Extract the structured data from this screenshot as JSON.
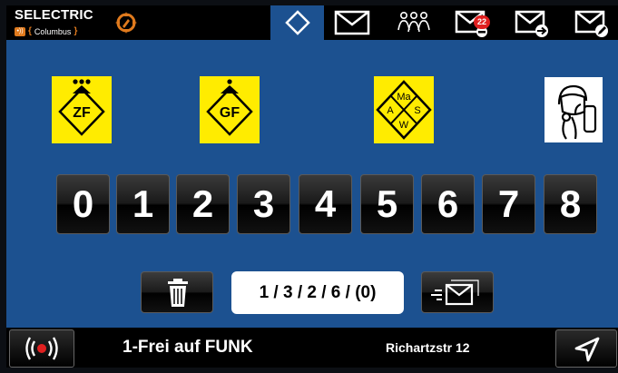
{
  "app": {
    "brand": "SELECTRIC",
    "product": "Columbus",
    "radio_badge": "•))"
  },
  "topbar": {
    "icons": [
      "diamond-icon",
      "mail-icon",
      "group-icon",
      "mail-badge-icon",
      "mail-forward-icon",
      "mail-edit-icon"
    ],
    "unread_count": "22"
  },
  "hazards": [
    {
      "name": "zf-sign",
      "label": "ZF"
    },
    {
      "name": "gf-sign",
      "label": "GF"
    },
    {
      "name": "maw-sign",
      "labels": [
        "Ma",
        "A",
        "S",
        "W"
      ]
    },
    {
      "name": "breathing-apparatus-sign",
      "icon": "respirator-icon"
    }
  ],
  "keypad": {
    "digits": [
      "0",
      "1",
      "2",
      "3",
      "4",
      "5",
      "6",
      "7",
      "8"
    ]
  },
  "controls": {
    "code": "1 / 3 / 2 / 6 / (0)",
    "delete_icon": "trash-icon",
    "send_icon": "mail-send-icon"
  },
  "status": {
    "text": "1-Frei auf FUNK",
    "address": "Richartzstr 12",
    "left_icon": "radio-signal-icon",
    "right_icon": "navigation-arrow-icon"
  },
  "colors": {
    "background": "#1c5190",
    "hazard_yellow": "#ffec00",
    "accent_orange": "#e07a1d",
    "badge_red": "#e02020"
  }
}
